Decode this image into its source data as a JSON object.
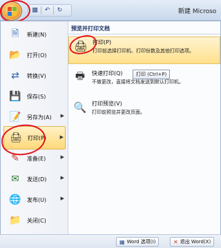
{
  "window": {
    "title": "新建 Microso"
  },
  "qat": {
    "icons": [
      "save-icon",
      "undo-icon",
      "redo-icon"
    ]
  },
  "menu": {
    "items": [
      {
        "label": "新建(N)",
        "icon": "new-doc-icon"
      },
      {
        "label": "打开(O)",
        "icon": "open-folder-icon"
      },
      {
        "label": "转换(V)",
        "icon": "convert-icon"
      },
      {
        "label": "保存(S)",
        "icon": "save-icon"
      },
      {
        "label": "另存为(A)",
        "icon": "save-as-icon"
      },
      {
        "label": "打印(P)",
        "icon": "printer-icon"
      },
      {
        "label": "准备(E)",
        "icon": "prepare-icon"
      },
      {
        "label": "发送(D)",
        "icon": "send-icon"
      },
      {
        "label": "发布(U)",
        "icon": "publish-icon"
      },
      {
        "label": "关闭(C)",
        "icon": "close-folder-icon"
      }
    ],
    "active_index": 5
  },
  "preview": {
    "heading": "预览并打印文档",
    "options": [
      {
        "title": "打印(P)",
        "desc": "打印前选择打印机、打印份数及其他打印选项。",
        "icon": "printer-icon"
      },
      {
        "title": "快速打印(Q)",
        "desc": "不做更改，直接将文档发送到默认打印机。",
        "icon": "quick-print-icon"
      },
      {
        "title": "打印预览(V)",
        "desc": "打印前预览并更改页面。",
        "icon": "print-preview-icon"
      }
    ],
    "tooltip": "打印 (Ctrl+P)"
  },
  "footer": {
    "word_options": "Word 选项(I)",
    "exit_word": "退出 Word(X)"
  },
  "colors": {
    "annotation": "#e3141b",
    "highlight": "#ffd97a"
  }
}
